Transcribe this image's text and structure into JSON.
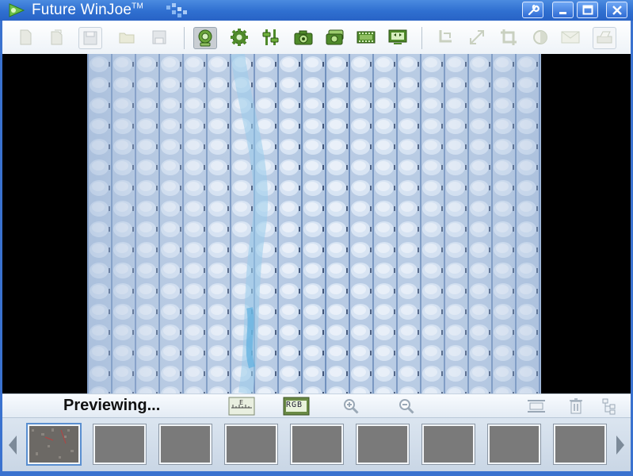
{
  "window": {
    "title": "Future WinJoe",
    "trademark": "TM",
    "buttons": [
      "settings-wrench",
      "minimize",
      "maximize",
      "close"
    ]
  },
  "toolbar": {
    "groups": [
      [
        "new-file-icon",
        "open-file-icon",
        "save-icon",
        "open-folder-icon",
        "save-as-icon"
      ],
      [
        "camera-preview-icon",
        "gear-icon",
        "sliders-icon",
        "camera-icon",
        "burst-camera-icon",
        "film-icon",
        "monitor-icon"
      ],
      [
        "rotate-icon",
        "resize-icon",
        "crop-icon",
        "contrast-icon",
        "envelope-icon",
        "print-icon"
      ]
    ]
  },
  "status": {
    "text": "Previewing...",
    "icons": [
      "measure-ruler-icon",
      "rgb-icon",
      "zoom-in-icon",
      "zoom-out-icon",
      "frame-icon",
      "trash-icon",
      "tree-icon"
    ],
    "rgb_label": "RGB"
  },
  "thumbnails": {
    "count": 9,
    "selected_index": 0
  },
  "colors": {
    "titlebar": "#2f6fd0",
    "fabric": "#b9cde6",
    "fiber_accent": "#7bbde4",
    "thumb_empty": "#7a7a7a"
  }
}
